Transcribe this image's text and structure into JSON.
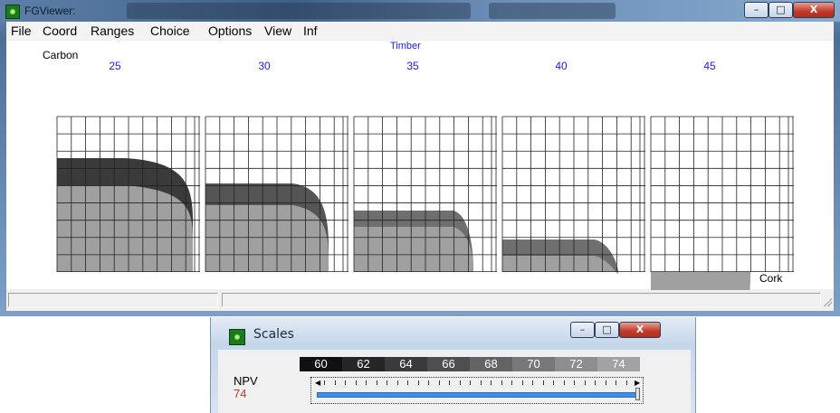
{
  "main_window": {
    "title": "FGViewer:",
    "menu": [
      "File",
      "Coord",
      "Ranges",
      "Choice",
      "Options",
      "View",
      "Inf"
    ],
    "buttons": {
      "minimize": "–",
      "maximize": "□",
      "close": "X"
    }
  },
  "plot": {
    "y_label": "Carbon",
    "top_label": "Timber",
    "x_label": "Cork",
    "panel_labels": [
      "25",
      "30",
      "35",
      "40",
      "45"
    ],
    "grid": true
  },
  "chart_data": {
    "type": "area",
    "facet_variable": "Timber",
    "facets": [
      "25",
      "30",
      "35",
      "40",
      "45"
    ],
    "xlabel": "Cork",
    "ylabel": "Carbon",
    "shades": [
      "#3a3a3a",
      "#555555",
      "#6f6f6f",
      "#888888",
      "#a0a0a0"
    ]
  },
  "scales_window": {
    "title": "Scales",
    "scale_values": [
      "60",
      "62",
      "64",
      "66",
      "68",
      "70",
      "72",
      "74"
    ],
    "scale_colors": [
      "#101010",
      "#262626",
      "#3a3a3a",
      "#4e4e4e",
      "#636363",
      "#787878",
      "#8d8d8d",
      "#a2a2a2"
    ],
    "npv_label": "NPV",
    "npv_value": "74",
    "slider_level": 1.0,
    "buttons": {
      "minimize": "–",
      "maximize": "□",
      "close": "X"
    }
  }
}
